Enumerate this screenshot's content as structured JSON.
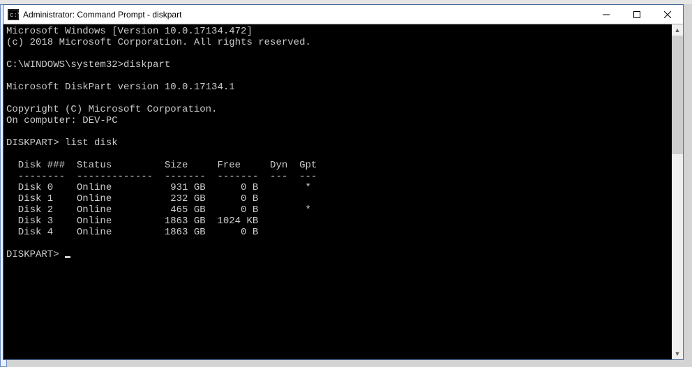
{
  "window": {
    "title": "Administrator: Command Prompt - diskpart"
  },
  "terminal": {
    "header_lines": [
      "Microsoft Windows [Version 10.0.17134.472]",
      "(c) 2018 Microsoft Corporation. All rights reserved.",
      "",
      "C:\\WINDOWS\\system32>diskpart",
      "",
      "Microsoft DiskPart version 10.0.17134.1",
      "",
      "Copyright (C) Microsoft Corporation.",
      "On computer: DEV-PC",
      "",
      "DISKPART> list disk",
      ""
    ],
    "table_header": "  Disk ###  Status         Size     Free     Dyn  Gpt",
    "table_divider": "  --------  -------------  -------  -------  ---  ---",
    "disks": [
      {
        "row": "  Disk 0    Online          931 GB      0 B        *"
      },
      {
        "row": "  Disk 1    Online          232 GB      0 B"
      },
      {
        "row": "  Disk 2    Online          465 GB      0 B        *"
      },
      {
        "row": "  Disk 3    Online         1863 GB  1024 KB"
      },
      {
        "row": "  Disk 4    Online         1863 GB      0 B"
      }
    ],
    "prompt": "DISKPART> "
  }
}
